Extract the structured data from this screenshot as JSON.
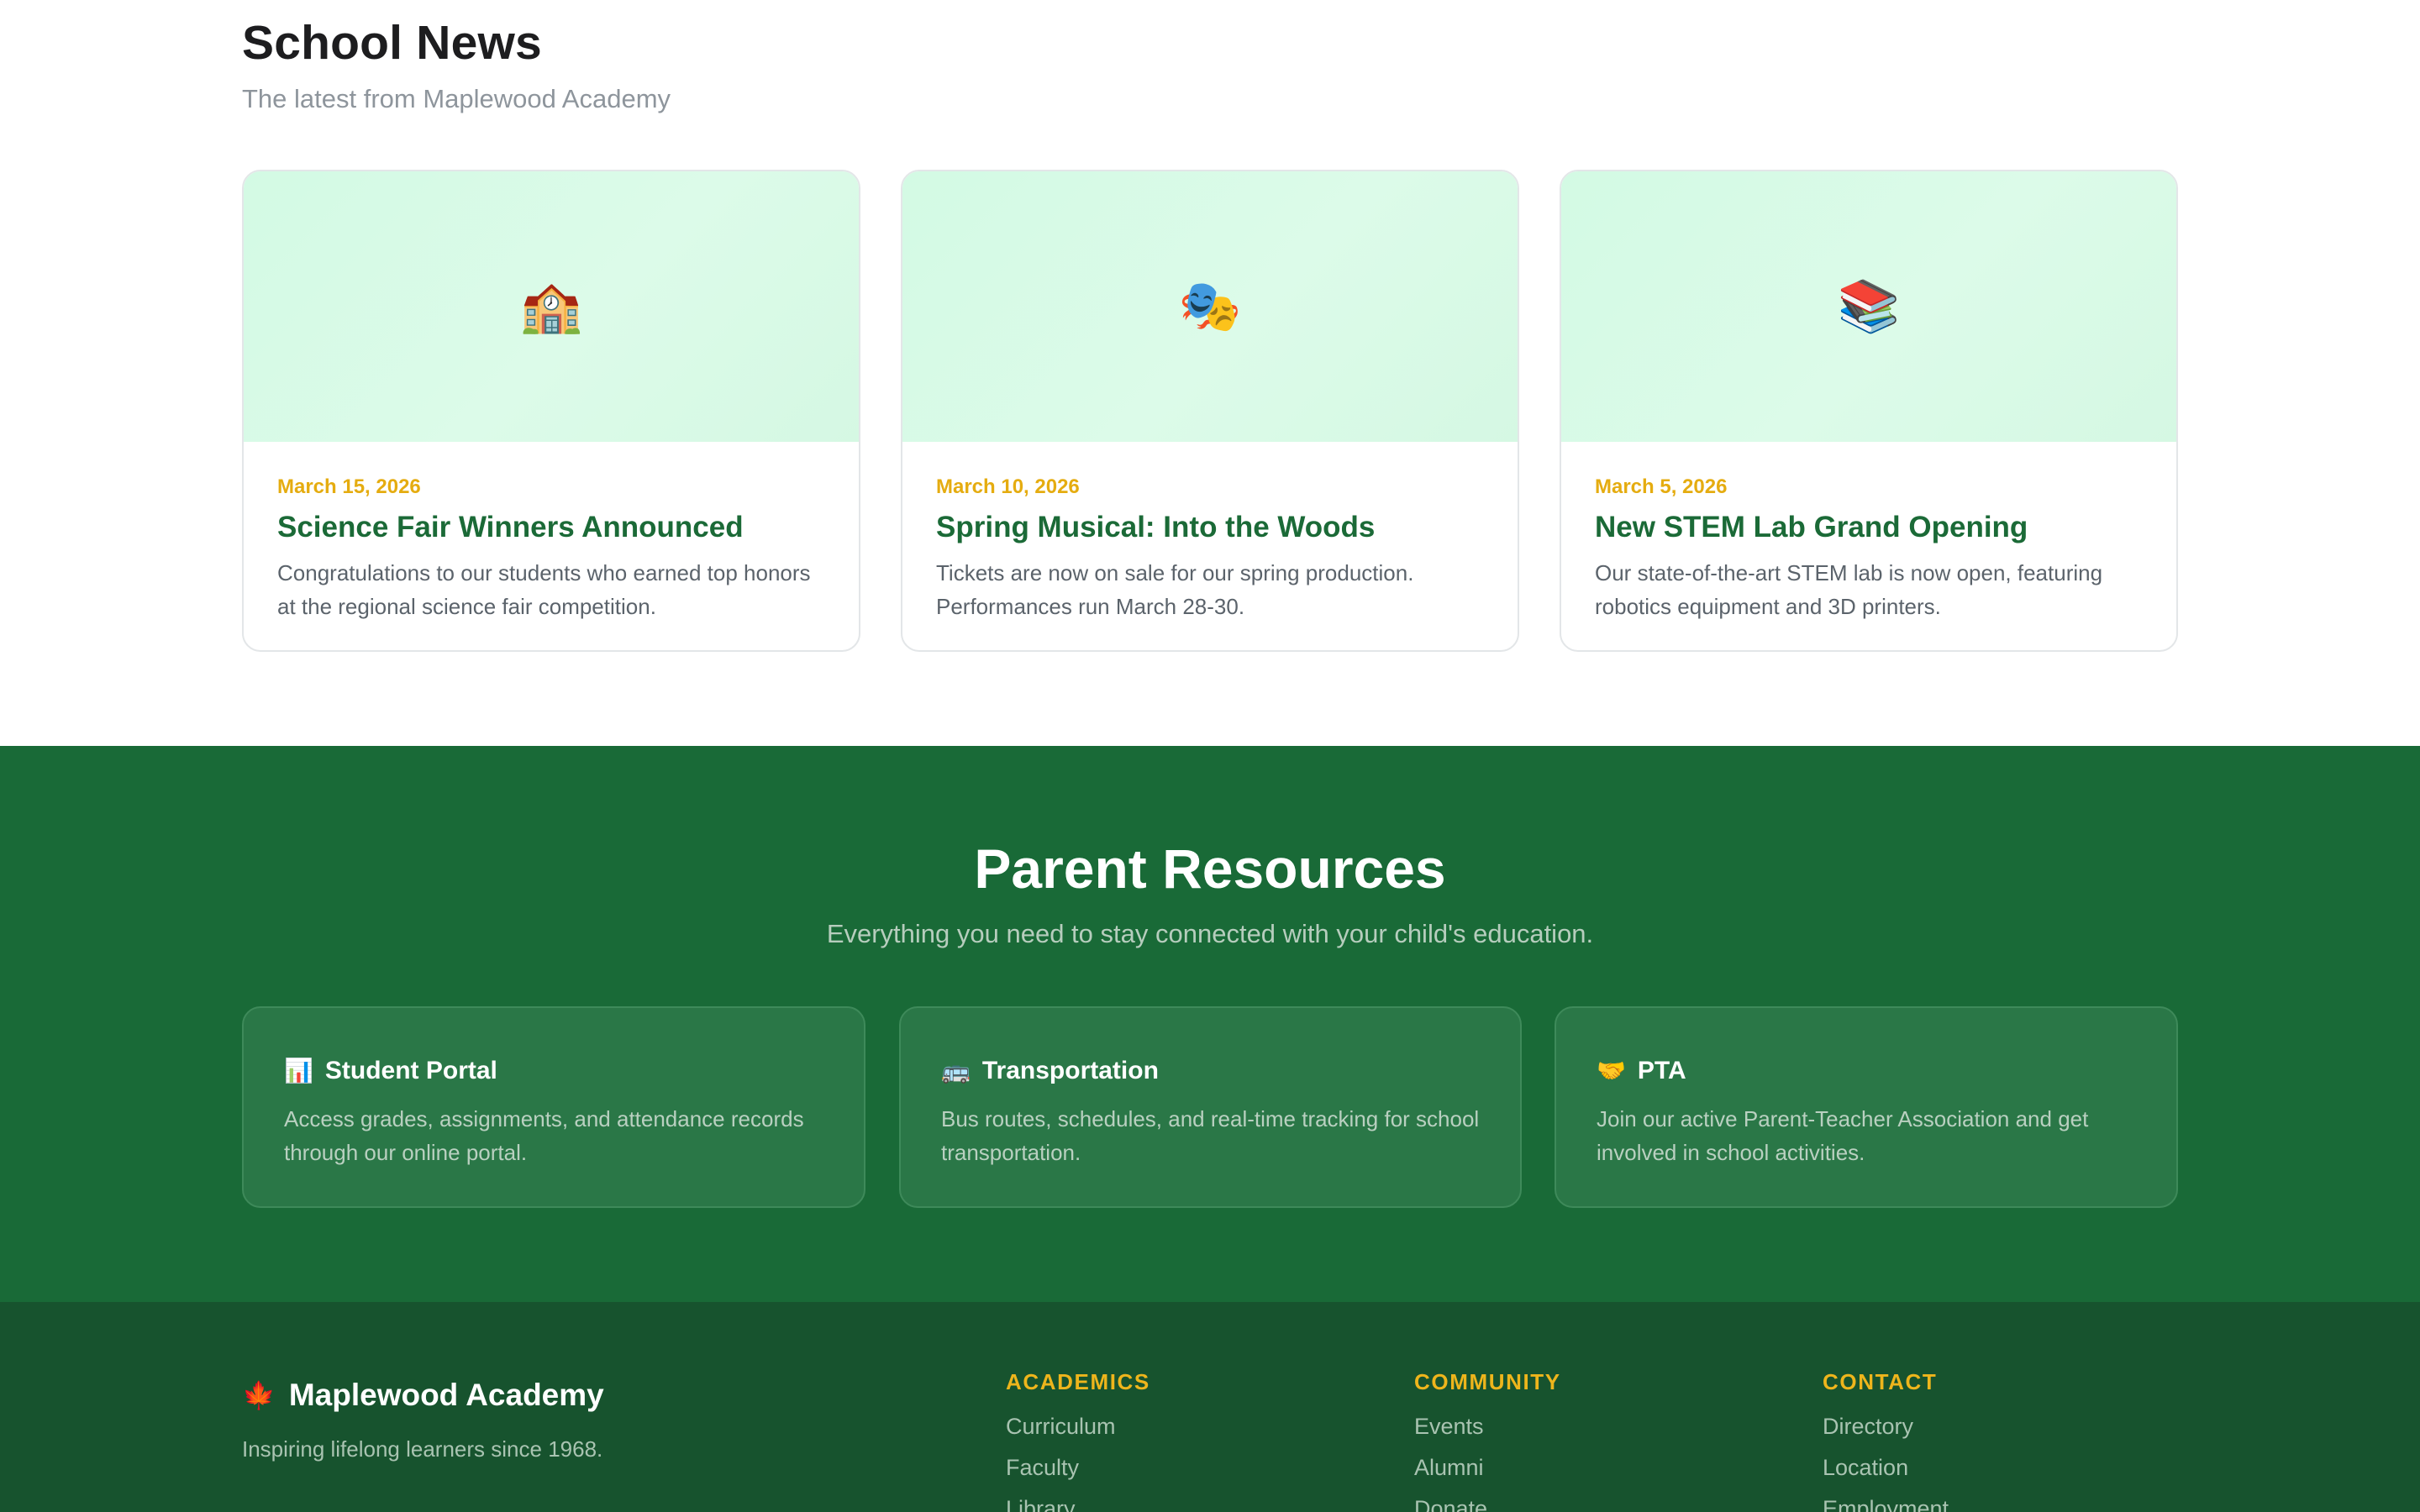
{
  "news": {
    "title": "School News",
    "subtitle": "The latest from Maplewood Academy",
    "cards": [
      {
        "icon": "🏫",
        "icon_name": "school-building-icon",
        "date": "March 15, 2026",
        "headline": "Science Fair Winners Announced",
        "text": "Congratulations to our students who earned top honors at the regional science fair competition."
      },
      {
        "icon": "🎭",
        "icon_name": "theater-masks-icon",
        "date": "March 10, 2026",
        "headline": "Spring Musical: Into the Woods",
        "text": "Tickets are now on sale for our spring production. Performances run March 28-30."
      },
      {
        "icon": "📚",
        "icon_name": "books-icon",
        "date": "March 5, 2026",
        "headline": "New STEM Lab Grand Opening",
        "text": "Our state-of-the-art STEM lab is now open, featuring robotics equipment and 3D printers."
      }
    ]
  },
  "resources": {
    "title": "Parent Resources",
    "subtitle": "Everything you need to stay connected with your child's education.",
    "items": [
      {
        "icon": "📊",
        "icon_name": "bar-chart-icon",
        "title": "Student Portal",
        "text": "Access grades, assignments, and attendance records through our online portal."
      },
      {
        "icon": "🚌",
        "icon_name": "bus-icon",
        "title": "Transportation",
        "text": "Bus routes, schedules, and real-time tracking for school transportation."
      },
      {
        "icon": "🤝",
        "icon_name": "handshake-icon",
        "title": "PTA",
        "text": "Join our active Parent-Teacher Association and get involved in school activities."
      }
    ]
  },
  "footer": {
    "brand_icon": "🍁",
    "brand_icon_name": "maple-leaf-icon",
    "brand": "Maplewood Academy",
    "tagline": "Inspiring lifelong learners since 1968.",
    "columns": [
      {
        "heading": "ACADEMICS",
        "links": [
          "Curriculum",
          "Faculty",
          "Library"
        ]
      },
      {
        "heading": "COMMUNITY",
        "links": [
          "Events",
          "Alumni",
          "Donate"
        ]
      },
      {
        "heading": "CONTACT",
        "links": [
          "Directory",
          "Location",
          "Employment"
        ]
      }
    ]
  },
  "colors": {
    "brand_green": "#196a37",
    "footer_green": "#17532e",
    "accent_gold": "#e5ac10",
    "card_media_mint": "#d3fae4"
  }
}
